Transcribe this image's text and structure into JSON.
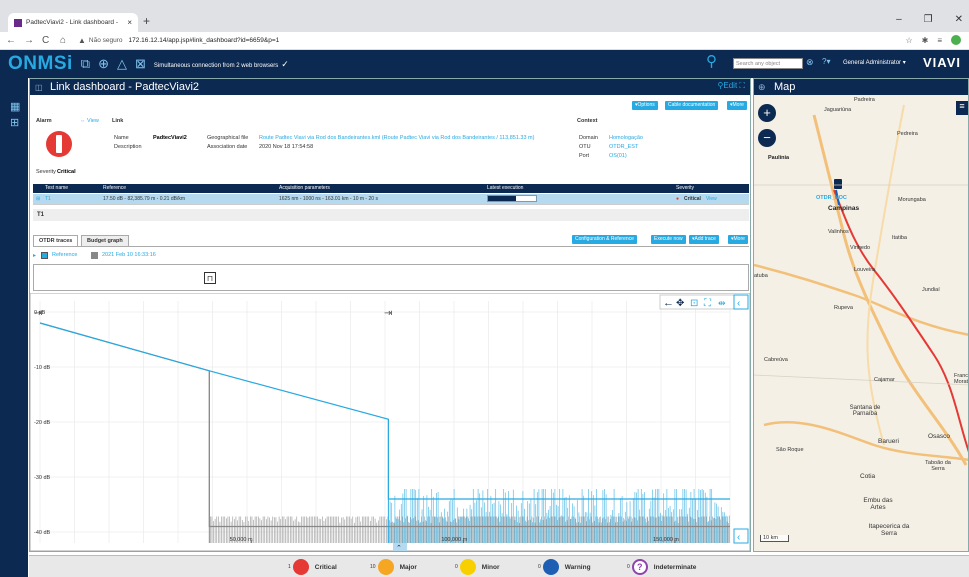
{
  "browser": {
    "tab_title": "PadtecViavi2 - Link dashboard - ",
    "new_tab": "+",
    "not_secure": "Não seguro",
    "url": "172.16.12.14/app.jsp#link_dashboard?id=6659&p=1",
    "win_controls": [
      "–",
      "❐",
      "✕"
    ]
  },
  "app": {
    "logo": "ONMSi",
    "message": "Simultaneous connection from 2 web browsers",
    "search_placeholder": "Search any object",
    "user": "General Administrator",
    "brand": "VIAVI"
  },
  "dashboard": {
    "title": "Link dashboard - PadtecViavi2",
    "edit": "Edit",
    "buttons": [
      "▾Options",
      "Cable documentation",
      "▾More"
    ],
    "alarm": {
      "header": "Alarm",
      "view": "View",
      "severity_label": "Severity",
      "severity": "Critical"
    },
    "link": {
      "header": "Link",
      "name_label": "Name",
      "name": "PadtecViavi2",
      "description_label": "Description",
      "geo_label": "Geographical file",
      "geo_value": "Route Padtec Viavi via Rod dos Bandeirantes.kml (Route Padtec Viavi via Rod dos Bandeirantes / 113,851.33 m)",
      "assoc_label": "Association date",
      "assoc_value": "2020 Nov 18 17:54:58"
    },
    "context": {
      "header": "Context",
      "domain_label": "Domain",
      "domain": "Homologação",
      "otu_label": "OTU",
      "otu": "OTDR_EST",
      "port_label": "Port",
      "port": "OS(01)"
    },
    "table": {
      "headers": [
        "Test name",
        "Reference",
        "Acquisition parameters",
        "Latest execution",
        "Severity"
      ],
      "row": {
        "test": "T1",
        "reference": "17.50 dB - 82,385.79 m - 0.21 dB/km",
        "params": "1625 nm - 1000 ns - 163.01 km - 10 m - 20 s",
        "severity": "Critical",
        "view": "View"
      }
    },
    "section": "T1",
    "tabs": [
      "OTDR traces",
      "Budget graph"
    ],
    "tab_buttons": [
      "Configuration & Reference",
      "Execute now",
      "▾Add trace",
      "▾More"
    ],
    "legend": {
      "reference": "Reference",
      "trace_date": "2021 Feb 10 16:33:16"
    },
    "chart_data": {
      "type": "line",
      "y_ticks": [
        "0 dB",
        "-10 dB",
        "-20 dB",
        "-30 dB",
        "-40 dB"
      ],
      "x_ticks": [
        "50,000 m",
        "100,000 m",
        "150,000 m"
      ],
      "ylim": [
        -42,
        2
      ],
      "xlim": [
        0,
        163000
      ],
      "series": [
        {
          "name": "Reference",
          "color": "#888888",
          "x": [
            0,
            40000,
            40000,
            163000
          ],
          "y": [
            -2,
            -10.7,
            -39,
            -39
          ]
        },
        {
          "name": "2021 Feb 10 16:33:16",
          "color": "#27a9e1",
          "x": [
            0,
            40000,
            82300,
            82300,
            163000
          ],
          "y": [
            -2,
            -10.7,
            -19.5,
            -34,
            -34
          ]
        }
      ]
    }
  },
  "map": {
    "title": "Map",
    "zoom_in": "+",
    "zoom_out": "−",
    "labels": [
      "Jaguariúna",
      "Pedreira",
      "Paulínia",
      "OTDR_NOC",
      "Morungaba",
      "Campinas",
      "Valinhos",
      "Itatiba",
      "Vinhedo",
      "Louveira",
      "Jundiaí",
      "Rupeva",
      "Cabreúva",
      "Cajamar",
      "Santana de Parnaíba",
      "Barueri",
      "Osasco",
      "São Roque",
      "Cotia",
      "Taboão da Serra",
      "Embu das Artes",
      "Itapecerica da Serra",
      "Francisco Morato",
      "atuba",
      "Padreira"
    ],
    "scale": "10 km"
  },
  "status": {
    "critical": {
      "label": "Critical",
      "count": "1"
    },
    "major": {
      "label": "Major",
      "count": "10"
    },
    "minor": {
      "label": "Minor",
      "count": "0"
    },
    "warning": {
      "label": "Warning",
      "count": "0"
    },
    "indeterminate": {
      "label": "Indeterminate",
      "count": "0"
    },
    "colors": {
      "critical": "#e53935",
      "major": "#f5a623",
      "minor": "#f8d000",
      "warning": "#1e5fb4",
      "indeterminate": "#8e44ad"
    }
  }
}
